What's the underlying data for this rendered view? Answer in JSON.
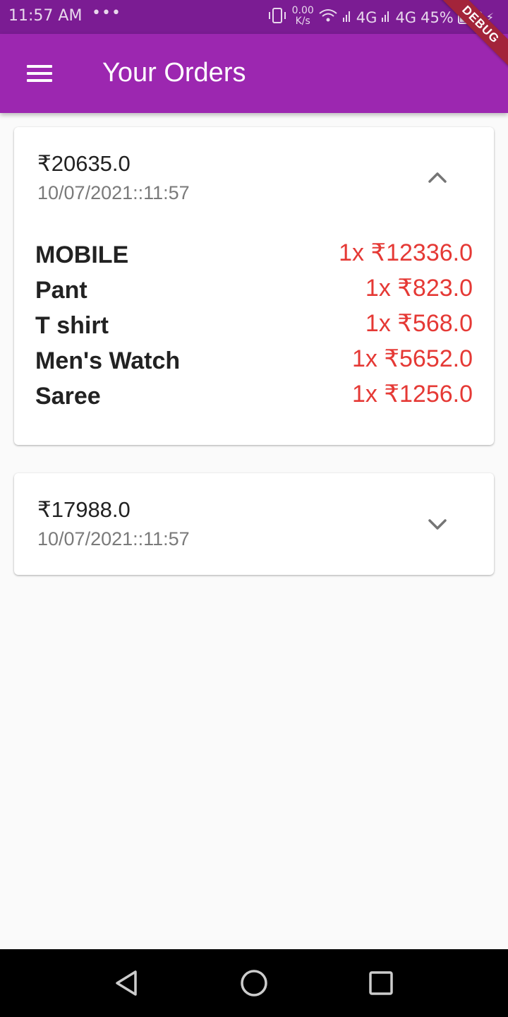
{
  "status_bar": {
    "time": "11:57 AM",
    "dots": "•••",
    "speed_value": "0.00",
    "speed_unit": "K/s",
    "network1": "4G",
    "network2": "4G",
    "battery": "45%",
    "battery_level": 0.45
  },
  "debug_banner": "DEBUG",
  "app_bar": {
    "title": "Your Orders",
    "menu_icon": "hamburger-menu-icon"
  },
  "orders": [
    {
      "amount": "₹20635.0",
      "date": "10/07/2021::11:57",
      "expanded": true,
      "items": [
        {
          "name": "MOBILE",
          "price": "1x ₹12336.0"
        },
        {
          "name": "Pant",
          "price": "1x ₹823.0"
        },
        {
          "name": "T shirt",
          "price": "1x ₹568.0"
        },
        {
          "name": "Men's Watch",
          "price": "1x ₹5652.0"
        },
        {
          "name": "Saree",
          "price": "1x ₹1256.0"
        }
      ]
    },
    {
      "amount": "₹17988.0",
      "date": "10/07/2021::11:57",
      "expanded": false,
      "items": []
    }
  ],
  "colors": {
    "app_bar": "#9c27b0",
    "status_bar": "#7b1c93",
    "price": "#e53935",
    "debug": "#a3243a"
  },
  "nav_bar": {
    "back_icon": "back-triangle-icon",
    "home_icon": "home-circle-icon",
    "recents_icon": "recents-square-icon"
  }
}
